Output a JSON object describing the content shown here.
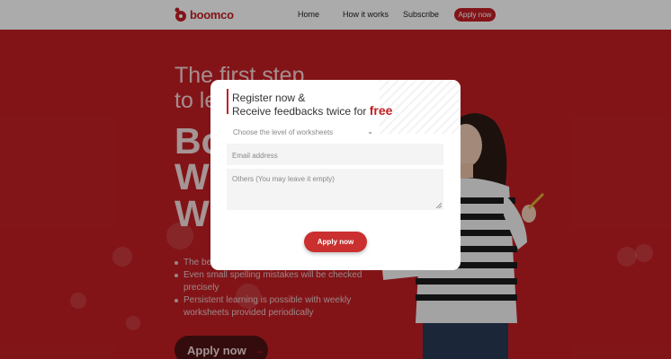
{
  "nav": {
    "logo_text": "boomco",
    "links": [
      "Home",
      "How it works",
      "Subscribe"
    ],
    "apply_label": "Apply now"
  },
  "hero": {
    "line1": "The first step",
    "line2": "to le",
    "big1": "Bo",
    "big2": "W",
    "big3": "W",
    "features": [
      "The be",
      "Even small spelling mistakes will be checked precisely",
      "Persistent learning is possible with weekly worksheets provided periodically"
    ],
    "apply_label": "Apply now",
    "apply_arrow": "→"
  },
  "modal": {
    "title_line1": "Register now &",
    "title_line2": "Receive feedbacks twice for ",
    "title_free": "free",
    "select_value": "Choose the level of worksheets",
    "email_placeholder": "Email address",
    "others_placeholder": "Others (You may leave it empty)",
    "apply_label": "Apply now"
  },
  "colors": {
    "brand": "#c21f24",
    "overlay": "rgba(0,0,0,0.33)"
  }
}
